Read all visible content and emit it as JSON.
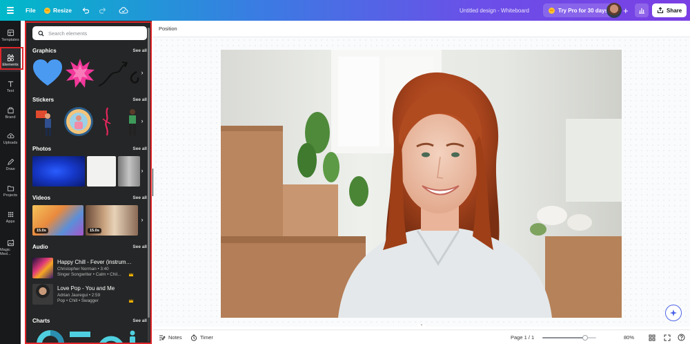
{
  "topbar": {
    "file_label": "File",
    "resize_label": "Resize",
    "document_title": "Untitled design - Whiteboard",
    "try_pro_label": "Try Pro for 30 days",
    "share_label": "Share",
    "plus_label": "+"
  },
  "rail": {
    "items": [
      {
        "label": "Templates",
        "icon": "templates-icon"
      },
      {
        "label": "Elements",
        "icon": "elements-icon"
      },
      {
        "label": "Text",
        "icon": "text-icon"
      },
      {
        "label": "Brand",
        "icon": "brand-icon"
      },
      {
        "label": "Uploads",
        "icon": "uploads-icon"
      },
      {
        "label": "Draw",
        "icon": "draw-icon"
      },
      {
        "label": "Projects",
        "icon": "projects-icon"
      },
      {
        "label": "Apps",
        "icon": "apps-icon"
      },
      {
        "label": "Magic Med...",
        "icon": "magic-media-icon"
      }
    ],
    "active": "Elements"
  },
  "panel": {
    "search_placeholder": "Search elements",
    "see_all": "See all",
    "sections": {
      "graphics": "Graphics",
      "stickers": "Stickers",
      "photos": "Photos",
      "videos": "Videos",
      "audio": "Audio",
      "charts": "Charts"
    },
    "videos": [
      {
        "duration": "15.0s"
      },
      {
        "duration": "15.0s"
      }
    ],
    "audio": [
      {
        "title": "Happy Chill - Fever (instrument...",
        "artist_duration": "Christopher Norman • 3:40",
        "tags": "Singer Songwriter • Calm • Chil..."
      },
      {
        "title": "Love Pop - You and Me",
        "artist_duration": "Adrian Jauregui • 2:59",
        "tags": "Pop • Chill • Swagger"
      }
    ]
  },
  "context_toolbar": {
    "position_label": "Position"
  },
  "bottombar": {
    "notes_label": "Notes",
    "timer_label": "Timer",
    "page_label": "Page 1 / 1",
    "zoom_percent": "80%",
    "zoom_fraction": 0.8
  },
  "colors": {
    "panel_bg": "#252627",
    "rail_bg": "#18191b",
    "highlight_red": "#e0262b",
    "accent": "#7a3fe4"
  }
}
